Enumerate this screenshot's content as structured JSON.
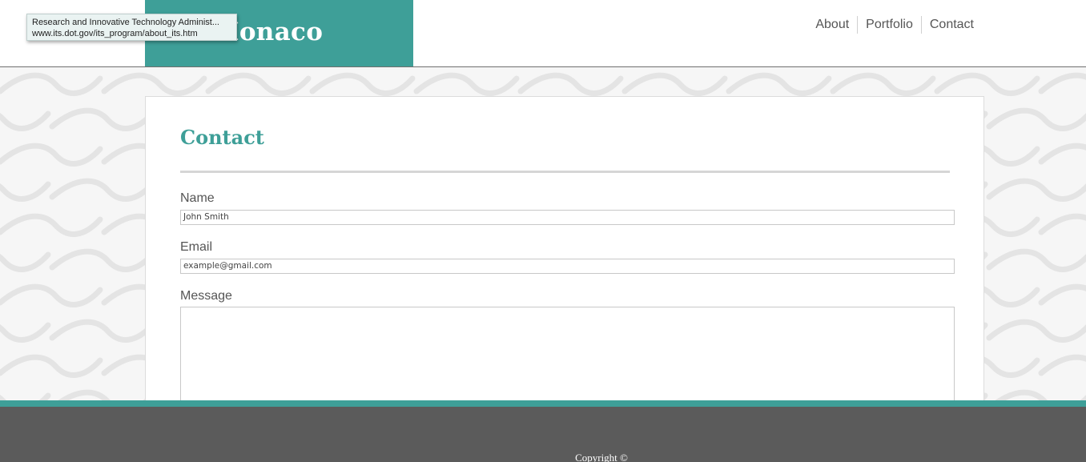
{
  "site": {
    "logo_text": "DeMonaco"
  },
  "nav": {
    "items": [
      {
        "label": "About"
      },
      {
        "label": "Portfolio"
      },
      {
        "label": "Contact"
      }
    ]
  },
  "tooltip": {
    "title": "Research and Innovative Technology Administ...",
    "url": "www.its.dot.gov/its_program/about_its.htm"
  },
  "contact": {
    "title": "Contact",
    "name_label": "Name",
    "name_value": "John Smith",
    "email_label": "Email",
    "email_value": "example@gmail.com",
    "message_label": "Message",
    "message_value": ""
  },
  "footer": {
    "copyright": "Copyright ©"
  },
  "colors": {
    "accent": "#3e9f98",
    "footer_bg": "#5b5b5b",
    "pattern_bg": "#f6f6f6"
  }
}
